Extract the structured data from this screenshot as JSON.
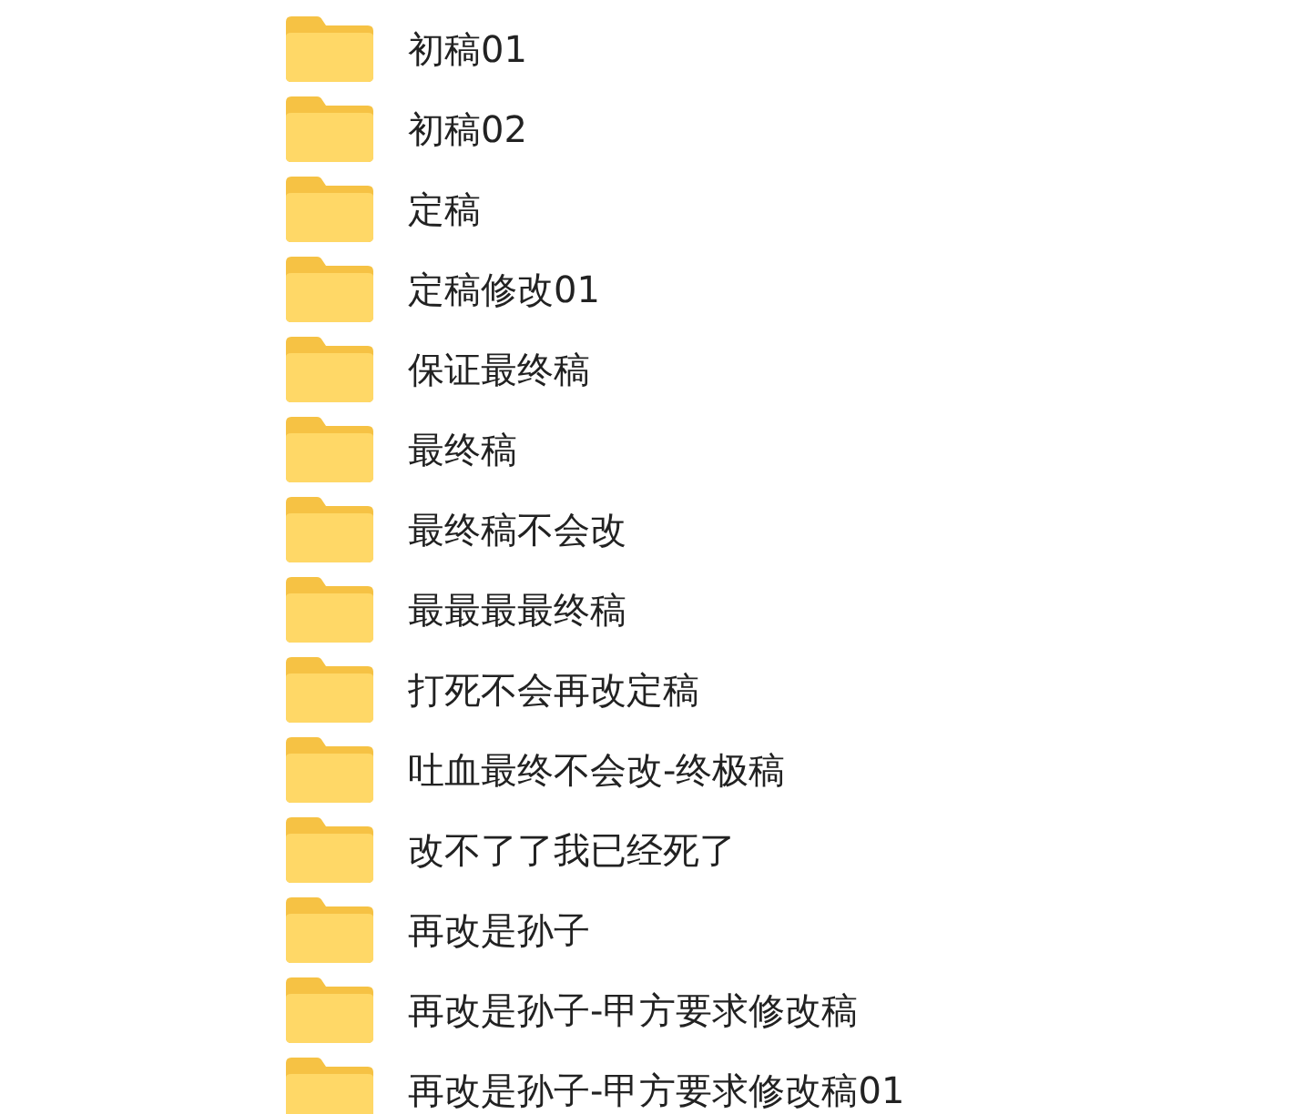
{
  "folders": [
    {
      "name": "初稿01"
    },
    {
      "name": "初稿02"
    },
    {
      "name": "定稿"
    },
    {
      "name": "定稿修改01"
    },
    {
      "name": "保证最终稿"
    },
    {
      "name": "最终稿"
    },
    {
      "name": "最终稿不会改"
    },
    {
      "name": "最最最最终稿"
    },
    {
      "name": "打死不会再改定稿"
    },
    {
      "name": "吐血最终不会改-终极稿"
    },
    {
      "name": "改不了了我已经死了"
    },
    {
      "name": "再改是孙子"
    },
    {
      "name": "再改是孙子-甲方要求修改稿"
    },
    {
      "name": "再改是孙子-甲方要求修改稿01"
    }
  ]
}
